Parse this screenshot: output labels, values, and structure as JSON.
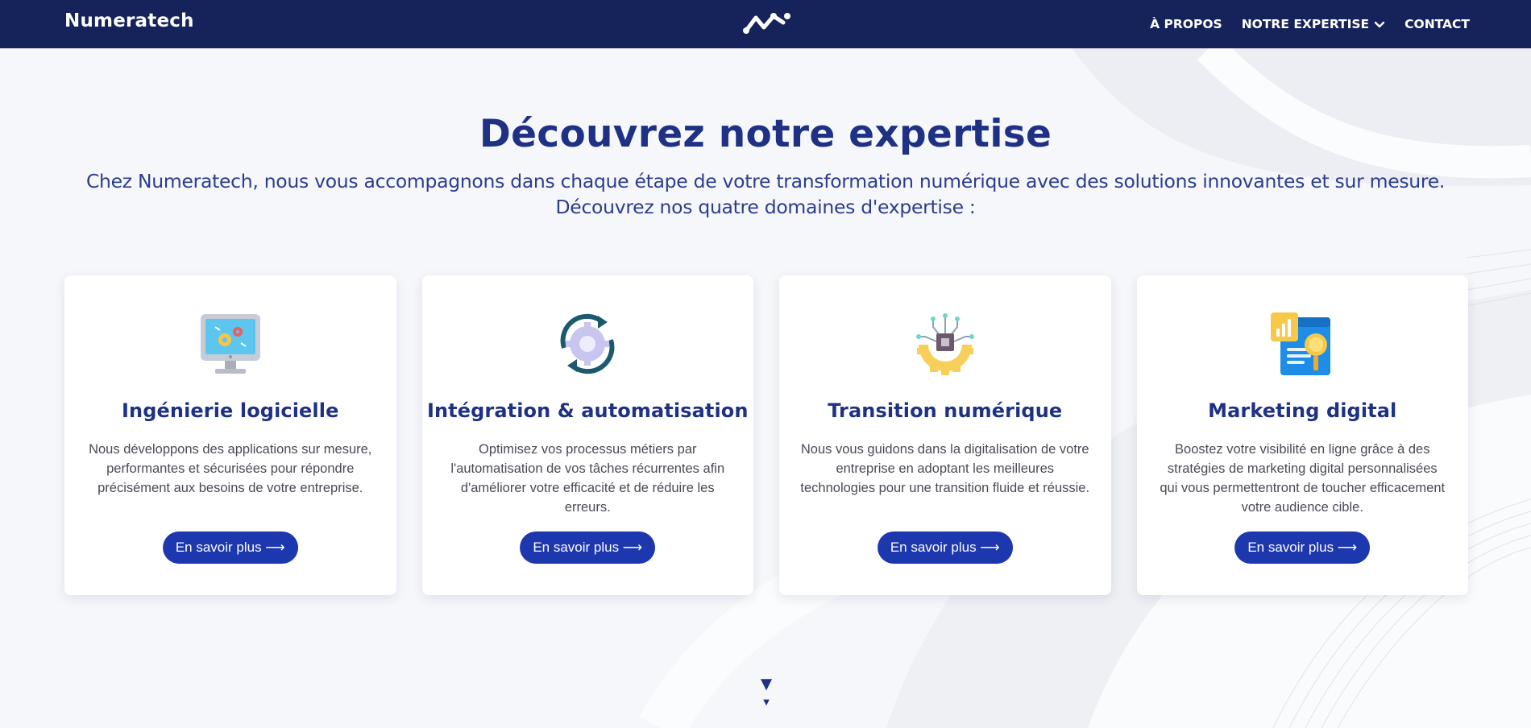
{
  "navbar": {
    "brand": "Numeratech",
    "logo_icon": "numeratech-logo-icon",
    "links": [
      {
        "label": "À PROPOS"
      },
      {
        "label": "NOTRE EXPERTISE",
        "icon": "chevron-down-icon"
      },
      {
        "label": "CONTACT"
      }
    ],
    "background": "#16225a"
  },
  "hero": {
    "title": "Découvrez notre expertise",
    "subtitle_line1": "Chez Numeratech, nous vous accompagnons dans chaque étape de votre transformation numérique avec des solutions innovantes et sur mesure.",
    "subtitle_line2": "Découvrez nos quatre domaines d'expertise :"
  },
  "cards": [
    {
      "icon": "computer-gears-icon",
      "title": "Ingénierie logicielle",
      "description": "Nous développons des applications sur mesure, performantes et sécurisées pour répondre précisément aux besoins de votre entreprise.",
      "button": "En savoir plus ⟶"
    },
    {
      "icon": "gear-cycle-icon",
      "title": "Intégration & automatisation",
      "description": "Optimisez vos processus métiers par l'automatisation de vos tâches récurrentes afin d'améliorer votre efficacité et de réduire les erreurs.",
      "button": "En savoir plus ⟶"
    },
    {
      "icon": "chip-gear-icon",
      "title": "Transition numérique",
      "description": "Nous vous guidons dans la digitalisation de votre entreprise en adoptant les meilleures technologies pour une transition fluide et réussie.",
      "button": "En savoir plus ⟶"
    },
    {
      "icon": "analytics-search-icon",
      "title": "Marketing digital",
      "description": "Boostez votre visibilité en ligne grâce à des stratégies de marketing digital personnalisées qui vous permettentront de toucher efficacement votre audience cible.",
      "button": "En savoir plus ⟶"
    }
  ],
  "scroll_indicator": {
    "icon": "scroll-down-icon",
    "big": "▼",
    "small": "▼"
  },
  "colors": {
    "primary": "#1e3185",
    "button": "#1d37ae",
    "text": "#4a4a55"
  }
}
